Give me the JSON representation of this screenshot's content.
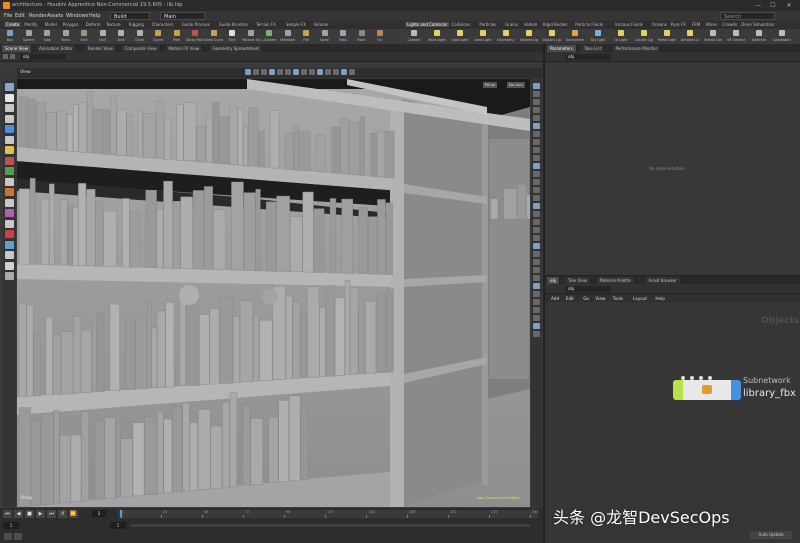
{
  "window": {
    "title": "architecture - Houdini Apprentice Non-Commercial 19.5.605 - lib.hip",
    "minimize": "—",
    "maximize": "☐",
    "close": "✕"
  },
  "menubar": {
    "items": [
      "File",
      "Edit",
      "Render",
      "Assets",
      "Windows",
      "Help"
    ],
    "desktop": "Build",
    "context": "Main",
    "search_placeholder": "Search"
  },
  "shelf_tabs_left": [
    "Create",
    "Modify",
    "Model",
    "Polygon",
    "Deform",
    "Texture",
    "Rigging",
    "Characters",
    "Guide Process",
    "Guide Brushes",
    "Terrain FX",
    "Simple FX",
    "Volume"
  ],
  "shelf_tabs_right": [
    "Lights and Cameras",
    "Collisions",
    "Particles",
    "Grains",
    "Vellum",
    "Rigid Bodies",
    "Particle Fluids",
    "Viscous Fluids",
    "Oceans",
    "Pyro FX",
    "FEM",
    "Wires",
    "Crowds",
    "Drive Simulation"
  ],
  "shelf_tools_left": [
    {
      "label": "Box",
      "color": "#7f9fc8"
    },
    {
      "label": "Sphere",
      "color": "#9aa4b0"
    },
    {
      "label": "Tube",
      "color": "#9aa4b0"
    },
    {
      "label": "Torus",
      "color": "#9aa4b0"
    },
    {
      "label": "Grid",
      "color": "#8aa07a"
    },
    {
      "label": "Null",
      "color": "#b0b0b0"
    },
    {
      "label": "Line",
      "color": "#b0b0b0"
    },
    {
      "label": "Circle",
      "color": "#b0b0b0"
    },
    {
      "label": "Curve",
      "color": "#c9a050"
    },
    {
      "label": "Path",
      "color": "#c9a050"
    },
    {
      "label": "Spray Paint",
      "color": "#c05050"
    },
    {
      "label": "Draw Curve",
      "color": "#c9a050"
    },
    {
      "label": "Font",
      "color": "#ddd"
    },
    {
      "label": "Platonic Solids",
      "color": "#9aa4b0"
    },
    {
      "label": "L-System",
      "color": "#7ab070"
    },
    {
      "label": "Metaball",
      "color": "#9aa4b0"
    },
    {
      "label": "File",
      "color": "#c9a050"
    },
    {
      "label": "Spiral",
      "color": "#9aa4b0"
    },
    {
      "label": "Helix",
      "color": "#9aa4b0"
    },
    {
      "label": "Rock",
      "color": "#8a8a8a"
    },
    {
      "label": "Fur",
      "color": "#c08050"
    }
  ],
  "shelf_tools_right": [
    {
      "label": "Camera",
      "color": "#bbbbbb"
    },
    {
      "label": "Point Light",
      "color": "#e8d060"
    },
    {
      "label": "Spot Light",
      "color": "#e8d060"
    },
    {
      "label": "Area Light",
      "color": "#e8d060"
    },
    {
      "label": "Geometry Light",
      "color": "#e8d060"
    },
    {
      "label": "Volume Light",
      "color": "#e8d060"
    },
    {
      "label": "Distant Light",
      "color": "#e8d060"
    },
    {
      "label": "Environment Light",
      "color": "#e8a040"
    },
    {
      "label": "Sky Light",
      "color": "#7fb0e0"
    },
    {
      "label": "GI Light",
      "color": "#e8d060"
    },
    {
      "label": "Caustic Light",
      "color": "#e8d060"
    },
    {
      "label": "Portal Light",
      "color": "#e8d060"
    },
    {
      "label": "Ambient Light",
      "color": "#e8d060"
    },
    {
      "label": "Stereo Camera",
      "color": "#bbbbbb"
    },
    {
      "label": "VR Camera",
      "color": "#bbbbbb"
    },
    {
      "label": "Switcher",
      "color": "#bbbbbb"
    },
    {
      "label": "Gamepad Camera",
      "color": "#bbbbbb"
    }
  ],
  "left_pane_tabs": [
    "Scene View",
    "Animation Editor",
    "Render View",
    "Composite View",
    "Motion FX View",
    "Geometry Spreadsheet"
  ],
  "left_path": "obj",
  "viewport": {
    "label_top_left": "View",
    "persp": "Persp",
    "camera": "No cam",
    "bottom_left": "Persp",
    "bottom_right": "Non-Commercial Edition"
  },
  "parm_pane_tabs": [
    "Parameters",
    "Take List",
    "Performance Monitor"
  ],
  "parm_path": "obj",
  "parm_empty": "No node selected",
  "net_pane_tabs": [
    "obj",
    "Tree View",
    "Material Palette",
    "Asset Browser"
  ],
  "net_path": "obj",
  "net_menu": [
    "Add",
    "Edit",
    "Go",
    "View",
    "Tools",
    "Layout",
    "Help"
  ],
  "network": {
    "context_label": "Objects",
    "node_type": "Subnetwork",
    "node_name": "library_fbx"
  },
  "timeline": {
    "frame": "1",
    "start": "1",
    "end": "1",
    "ticks": [
      "1",
      "24",
      "48",
      "72",
      "96",
      "120",
      "144",
      "168",
      "192",
      "216",
      "240"
    ]
  },
  "status": {
    "auto_update": "Auto Update"
  },
  "watermark": "头条 @龙智DevSecOps"
}
